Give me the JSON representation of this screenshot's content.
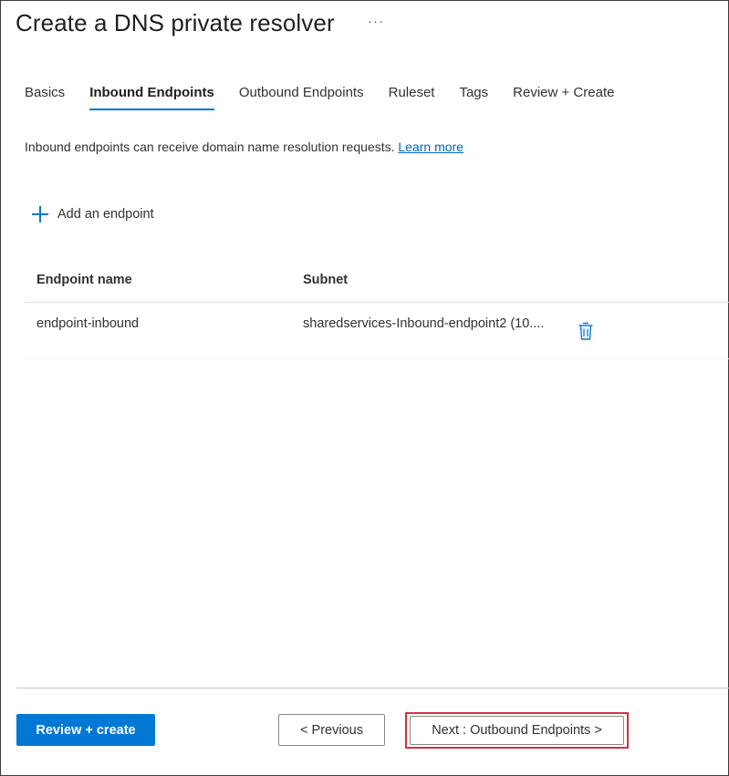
{
  "header": {
    "title": "Create a DNS private resolver",
    "more_label": "···"
  },
  "tabs": [
    {
      "label": "Basics",
      "active": false
    },
    {
      "label": "Inbound Endpoints",
      "active": true
    },
    {
      "label": "Outbound Endpoints",
      "active": false
    },
    {
      "label": "Ruleset",
      "active": false
    },
    {
      "label": "Tags",
      "active": false
    },
    {
      "label": "Review + Create",
      "active": false
    }
  ],
  "description": {
    "text": "Inbound endpoints can receive domain name resolution requests. ",
    "link": "Learn more"
  },
  "add_endpoint": {
    "label": "Add an endpoint",
    "icon": "plus-icon"
  },
  "table": {
    "columns": [
      "Endpoint name",
      "Subnet"
    ],
    "rows": [
      {
        "name": "endpoint-inbound",
        "subnet": "sharedservices-Inbound-endpoint2 (10...."
      }
    ]
  },
  "footer": {
    "primary_label": "Review + create",
    "previous_label": "< Previous",
    "next_label": "Next : Outbound Endpoints >"
  },
  "colors": {
    "accent": "#0078d4",
    "highlight": "#d13438"
  }
}
